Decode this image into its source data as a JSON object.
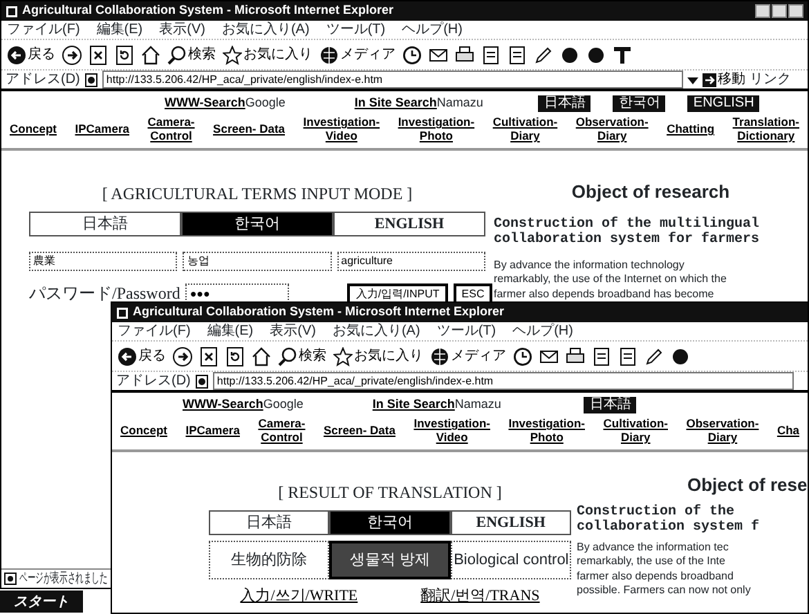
{
  "windows": [
    {
      "title": "Agricultural Collaboration System - Microsoft Internet Explorer",
      "window_buttons": true,
      "menu": [
        "ファイル(F)",
        "編集(E)",
        "表示(V)",
        "お気に入り(A)",
        "ツール(T)",
        "ヘルプ(H)"
      ],
      "toolbar": [
        {
          "kind": "back",
          "label": "戻る"
        },
        {
          "kind": "forward"
        },
        {
          "kind": "stop"
        },
        {
          "kind": "refresh"
        },
        {
          "kind": "home"
        },
        {
          "kind": "search",
          "label": "検索"
        },
        {
          "kind": "favorites",
          "label": "お気に入り"
        },
        {
          "kind": "media",
          "label": "メディア"
        },
        {
          "kind": "history"
        },
        {
          "kind": "mail"
        },
        {
          "kind": "print"
        },
        {
          "kind": "page"
        },
        {
          "kind": "page"
        },
        {
          "kind": "pencil"
        },
        {
          "kind": "dot"
        },
        {
          "kind": "dot"
        },
        {
          "kind": "text"
        }
      ],
      "address": {
        "label": "アドレス(D)",
        "url": "http://133.5.206.42/HP_aca/_private/english/index-e.htm",
        "go": "移動",
        "links": "リンク"
      },
      "search": [
        {
          "link": "WWW-Search",
          "engine": "Google"
        },
        {
          "link": "In Site Search",
          "engine": "Namazu"
        }
      ],
      "language_buttons": [
        "日本語",
        "한국어",
        "ENGLISH"
      ],
      "nav": [
        "Concept",
        "IPCamera",
        "Camera-\nControl",
        "Screen- Data",
        "Investigation-\nVideo",
        "Investigation-\nPhoto",
        "Cultivation-\nDiary",
        "Observation-\nDiary",
        "Chatting",
        "Translation-\nDictionary"
      ],
      "panel": {
        "kind": "input",
        "heading": "[ AGRICULTURAL TERMS INPUT MODE ]",
        "languages": [
          {
            "label": "日本語",
            "selected": false
          },
          {
            "label": "한국어",
            "selected": true
          },
          {
            "label": "ENGLISH",
            "selected": false
          }
        ],
        "terms": [
          "農業",
          "농업",
          "agriculture"
        ],
        "password_label": "パスワード/Password",
        "password": "●●●",
        "buttons": [
          "入力/입력/INPUT",
          "ESC"
        ]
      },
      "article": {
        "title": "Object of research",
        "subtitle_lines": [
          "Construction of the multilingual",
          "collaboration system for farmers"
        ],
        "body_lines": [
          "By advance the information technology",
          "remarkably,  the use of the Internet on which the",
          "farmer also depends broadband has become"
        ]
      },
      "status_bar": "ページが表示されました"
    },
    {
      "title": "Agricultural Collaboration System - Microsoft Internet Explorer",
      "window_buttons": false,
      "menu": [
        "ファイル(F)",
        "編集(E)",
        "表示(V)",
        "お気に入り(A)",
        "ツール(T)",
        "ヘルプ(H)"
      ],
      "toolbar": [
        {
          "kind": "back",
          "label": "戻る"
        },
        {
          "kind": "forward"
        },
        {
          "kind": "stop"
        },
        {
          "kind": "refresh"
        },
        {
          "kind": "home"
        },
        {
          "kind": "search",
          "label": "検索"
        },
        {
          "kind": "favorites",
          "label": "お気に入り"
        },
        {
          "kind": "media",
          "label": "メディア"
        },
        {
          "kind": "history"
        },
        {
          "kind": "mail"
        },
        {
          "kind": "print"
        },
        {
          "kind": "page"
        },
        {
          "kind": "page"
        },
        {
          "kind": "pencil"
        },
        {
          "kind": "dot"
        }
      ],
      "address": {
        "label": "アドレス(D)",
        "url": "http://133.5.206.42/HP_aca/_private/english/index-e.htm"
      },
      "search": [
        {
          "link": "WWW-Search",
          "engine": "Google"
        },
        {
          "link": "In Site Search",
          "engine": "Namazu"
        }
      ],
      "language_buttons": [
        "日本語"
      ],
      "nav": [
        "Concept",
        "IPCamera",
        "Camera-\nControl",
        "Screen- Data",
        "Investigation-\nVideo",
        "Investigation-\nPhoto",
        "Cultivation-\nDiary",
        "Observation-\nDiary",
        "Cha"
      ],
      "panel": {
        "kind": "result",
        "heading": "[ RESULT OF TRANSLATION ]",
        "languages": [
          {
            "label": "日本語",
            "selected": false
          },
          {
            "label": "한국어",
            "selected": true
          },
          {
            "label": "ENGLISH",
            "selected": false
          }
        ],
        "results": [
          {
            "text": "生物的防除",
            "highlighted": false
          },
          {
            "text": "생물적 방제",
            "highlighted": true
          },
          {
            "text": "Biological control",
            "highlighted": false
          }
        ],
        "links": [
          "入力/쓰기/WRITE",
          "翻訳/번역/TRANS"
        ]
      },
      "article": {
        "title": "Object of rese",
        "subtitle_lines": [
          "Construction of the",
          "collaboration system f"
        ],
        "body_lines": [
          "By advance the information tec",
          "remarkably,  the use of the Inte",
          "farmer also depends broadband",
          "possible. Farmers can now not only"
        ]
      }
    }
  ],
  "taskbar": {
    "start": "スタート"
  }
}
